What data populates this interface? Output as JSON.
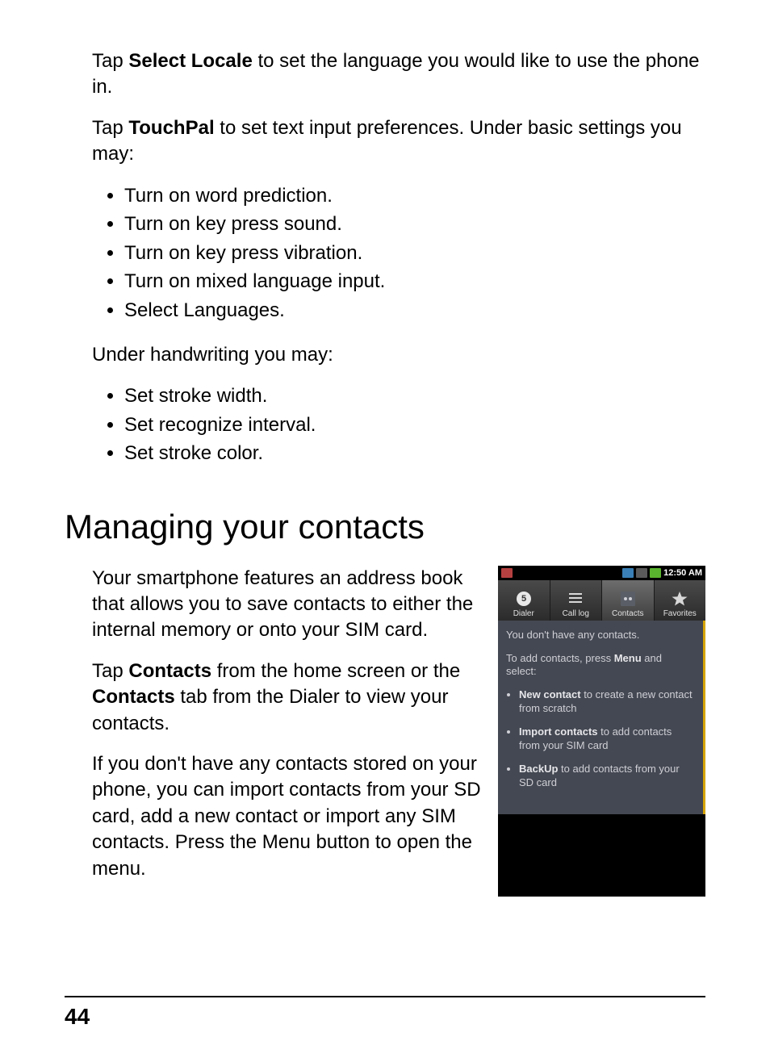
{
  "para1": {
    "pre": "Tap ",
    "bold": "Select Locale",
    "post": " to set the language you would like to use the phone in."
  },
  "para2": {
    "pre": "Tap ",
    "bold": "TouchPal",
    "post": " to set text input preferences. Under basic settings you may:"
  },
  "list1": [
    "Turn on word prediction.",
    "Turn on key press sound.",
    "Turn on key press vibration.",
    "Turn on mixed language input.",
    "Select Languages."
  ],
  "para3": "Under handwriting you may:",
  "list2": [
    "Set stroke width.",
    "Set recognize interval.",
    "Set stroke color."
  ],
  "heading": "Managing your contacts",
  "col_para1": "Your smartphone features an address book that allows you to save contacts to either the internal memory or onto your SIM card.",
  "col_para2": {
    "a": "Tap ",
    "b1": "Contacts",
    "c": " from the home screen or the ",
    "b2": "Contacts",
    "d": " tab from the Dialer to view your contacts."
  },
  "col_para3": "If you don't have any contacts stored on your phone, you can import contacts from your SD card, add a new contact or import any SIM contacts. Press the Menu button to open the menu.",
  "phone": {
    "time": "12:50 AM",
    "tabs": [
      {
        "label": "Dialer",
        "icon": "dialer-icon"
      },
      {
        "label": "Call log",
        "icon": "calllog-icon"
      },
      {
        "label": "Contacts",
        "icon": "contacts-icon",
        "active": true
      },
      {
        "label": "Favorites",
        "icon": "favorites-icon"
      }
    ],
    "msg_no_contacts": "You don't have any contacts.",
    "msg_add": {
      "pre": "To add contacts, press ",
      "bold": "Menu",
      "post": " and select:"
    },
    "items": [
      {
        "bold": "New contact",
        "rest": " to create a new contact from scratch"
      },
      {
        "bold": "Import contacts",
        "rest": " to add contacts from your SIM card"
      },
      {
        "bold": "BackUp",
        "rest": " to add contacts from your SD card"
      }
    ]
  },
  "page_number": "44"
}
